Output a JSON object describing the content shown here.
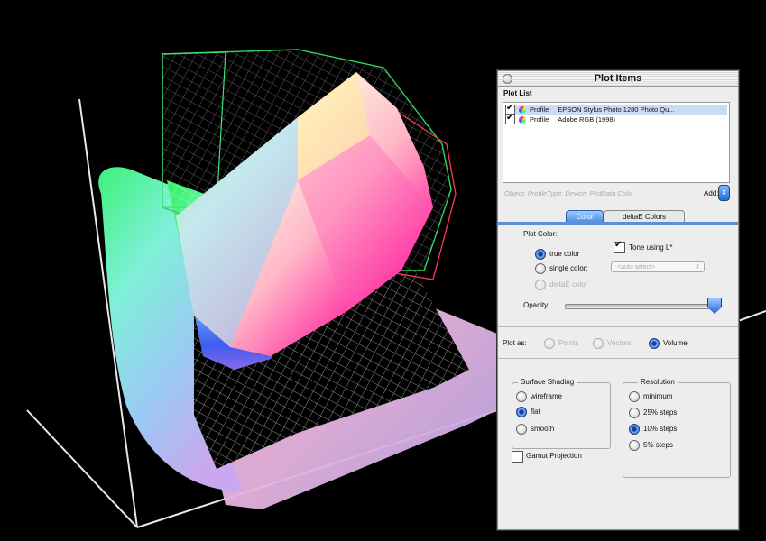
{
  "window": {
    "title": "Plot Items",
    "plot_list_label": "Plot List",
    "items": [
      {
        "checked": true,
        "type": "Profile",
        "name": "EPSON Stylus Photo 1280 Photo Qu..."
      },
      {
        "checked": true,
        "type": "Profile",
        "name": "Adobe RGB (1998)"
      }
    ],
    "info_placeholder": "Object: ProfileType: Device: PlotData Colo",
    "add_label": "Add:",
    "tabs": [
      {
        "label": "Color",
        "active": true
      },
      {
        "label": "deltaE Colors",
        "active": false
      }
    ],
    "plot_color_label": "Plot Color:",
    "true_color_label": "true color",
    "tone_using_label": "Tone using L*",
    "single_color_label": "single color:",
    "select_placeholder": "<auto select>",
    "deltae_color_label": "deltaE color",
    "opacity_label": "Opacity:",
    "opacity_value": 1.0,
    "plot_as_label": "Plot as:",
    "plot_as_options": [
      "Points",
      "Vectors",
      "Volume"
    ],
    "plot_as_selected": "Volume",
    "surface_shading": {
      "title": "Surface Shading",
      "options": [
        "wireframe",
        "flat",
        "smooth"
      ],
      "selected": "flat"
    },
    "resolution": {
      "title": "Resolution",
      "options": [
        "minimum",
        "25% steps",
        "10% steps",
        "5% steps"
      ],
      "selected": "10% steps"
    },
    "gamut_projection_label": "Gamut Projection",
    "gamut_projection_checked": false
  },
  "colors": {
    "accent": "#2d6bd6",
    "background": "#000000",
    "panel": "#ededed"
  }
}
